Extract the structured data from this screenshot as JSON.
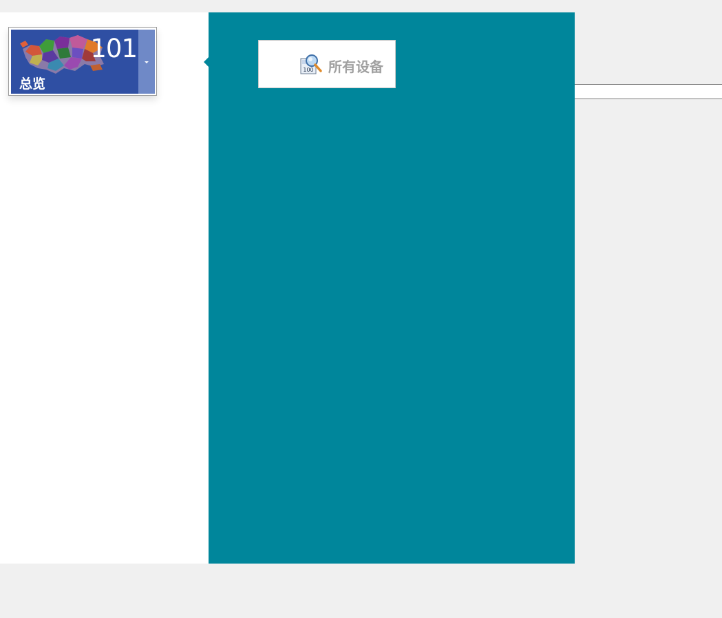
{
  "overview_tile": {
    "count": "101",
    "label": "总览",
    "colors": {
      "tile": "#2f4fa3",
      "dropdown": "#6f89c7"
    },
    "image": "colorful-region-map",
    "dropdown_icon": "caret-down-icon"
  },
  "device_button": {
    "label": "所有设备",
    "icon": "magnifier-100-icon",
    "icon_text": "100"
  },
  "theme": {
    "main_panel": "#00869b",
    "left_panel": "#ffffff",
    "background": "#f0f0f0"
  }
}
